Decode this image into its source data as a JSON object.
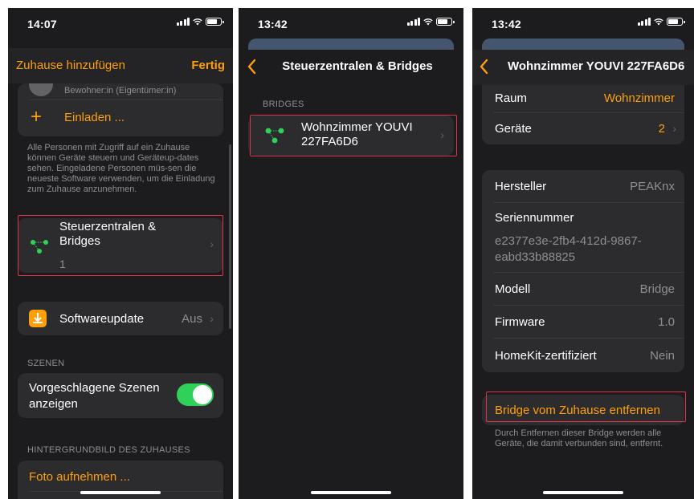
{
  "screen1": {
    "status_time": "14:07",
    "nav_left": "Zuhause hinzufügen",
    "nav_right": "Fertig",
    "user_subtitle": "Bewohner:in (Eigentümer:in)",
    "invite_label": "Einladen ...",
    "invite_plus": "+",
    "people_caption": "Alle Personen mit Zugriff auf ein Zuhause können Geräte steuern und Geräteup-dates sehen. Eingeladene Personen müs-sen die neueste Software verwenden, um die Einladung zum Zuhause anzunehmen.",
    "bridges_label": "Steuerzentralen & Bridges",
    "bridges_count": "1",
    "update_label": "Softwareupdate",
    "update_value": "Aus",
    "scenes_header": "SZENEN",
    "scenes_toggle_label": "Vorgeschlagene Szenen anzeigen",
    "scenes_toggle_on": true,
    "wallpaper_header": "HINTERGRUNDBILD DES ZUHAUSES",
    "photo_label": "Foto aufnehmen ..."
  },
  "screen2": {
    "status_time": "13:42",
    "nav_title": "Steuerzentralen & Bridges",
    "section_header": "BRIDGES",
    "bridge_name": "Wohnzimmer YOUVI 227FA6D6"
  },
  "screen3": {
    "status_time": "13:42",
    "nav_title": "Wohnzimmer YOUVI 227FA6D6",
    "room_label": "Raum",
    "room_value": "Wohnzimmer",
    "devices_label": "Geräte",
    "devices_value": "2",
    "manufacturer_label": "Hersteller",
    "manufacturer_value": "PEAKnx",
    "serial_label": "Seriennummer",
    "serial_value": "e2377e3e-2fb4-412d-9867-eabd33b88825",
    "model_label": "Modell",
    "model_value": "Bridge",
    "firmware_label": "Firmware",
    "firmware_value": "1.0",
    "homekit_label": "HomeKit-zertifiziert",
    "homekit_value": "Nein",
    "remove_label": "Bridge vom Zuhause entfernen",
    "remove_caption": "Durch Entfernen dieser Bridge werden alle Geräte, die damit verbunden sind, entfernt."
  },
  "colors": {
    "accent": "#ff9f0a",
    "background": "#1c1c1e",
    "cell": "#2c2c2e",
    "highlight": "#e1344a",
    "toggle_on": "#30d158",
    "bridge_icon": "#30d158"
  },
  "icons": [
    "signal-icon",
    "wifi-icon",
    "battery-icon",
    "back-chevron-icon",
    "chevron-right-icon",
    "bridge-icon",
    "plus-icon",
    "software-update-icon",
    "toggle-switch"
  ]
}
